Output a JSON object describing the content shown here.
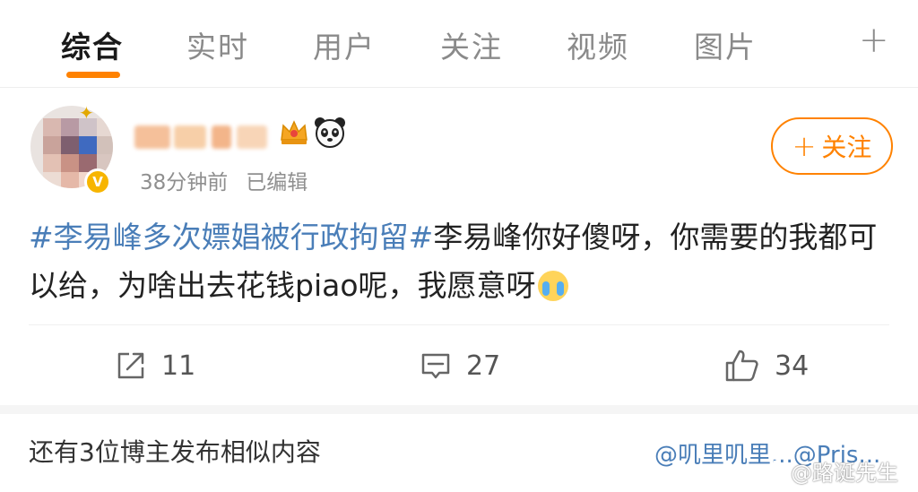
{
  "tabs": [
    {
      "label": "综合",
      "active": true
    },
    {
      "label": "实时"
    },
    {
      "label": "用户"
    },
    {
      "label": "关注"
    },
    {
      "label": "视频"
    },
    {
      "label": "图片"
    }
  ],
  "tabs_add_label": "+",
  "post": {
    "time": "38分钟前",
    "edited": "已编辑",
    "follow_label": "关注",
    "hashtag": "#李易峰多次嫖娼被行政拘留#",
    "text": "李易峰你好傻呀，你需要的我都可以给，为啥出去花钱piao呢，我愿意呀"
  },
  "actions": {
    "repost_count": "11",
    "comment_count": "27",
    "like_count": "34"
  },
  "similar": {
    "text": "还有3位博主发布相似内容",
    "users": "@叽里叽里...@Pris..."
  },
  "watermark": "@路诞先生",
  "colors": {
    "accent": "#ff8200",
    "link": "#4a7eb8"
  }
}
